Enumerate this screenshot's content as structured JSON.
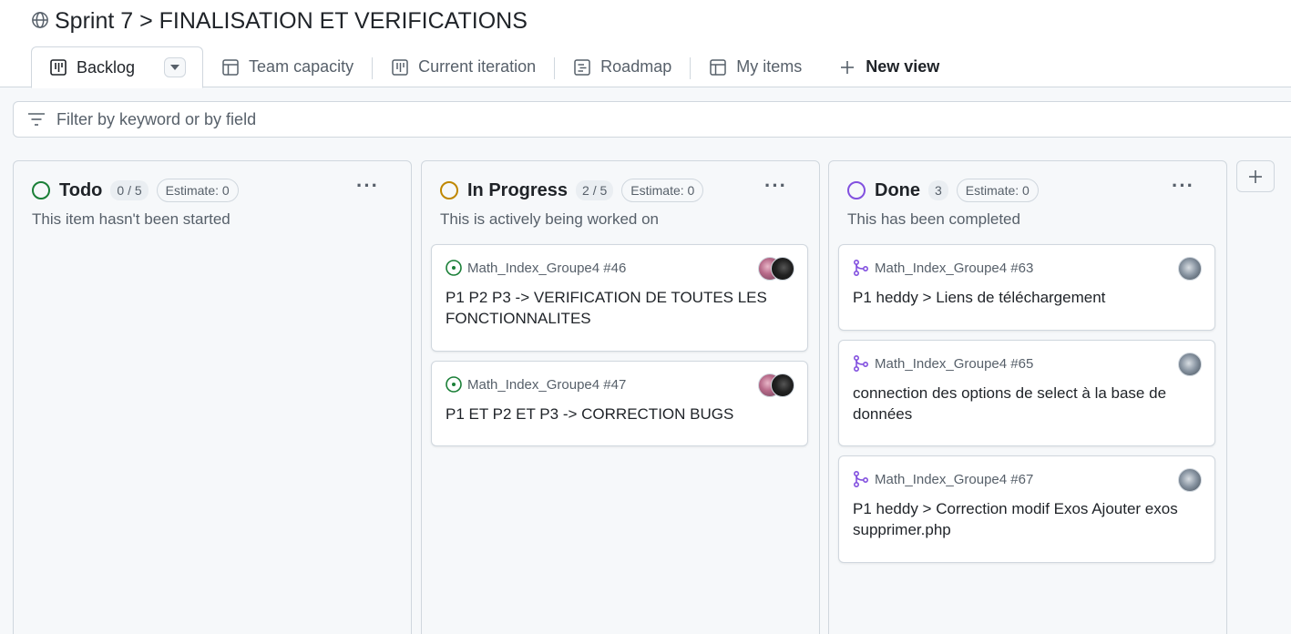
{
  "project": {
    "title": "Sprint 7 > FINALISATION ET VERIFICATIONS"
  },
  "tabs": [
    {
      "label": "Backlog"
    },
    {
      "label": "Team capacity"
    },
    {
      "label": "Current iteration"
    },
    {
      "label": "Roadmap"
    },
    {
      "label": "My items"
    },
    {
      "label": "New view"
    }
  ],
  "filter": {
    "placeholder": "Filter by keyword or by field"
  },
  "columns": [
    {
      "name": "Todo",
      "count": "0 / 5",
      "estimate": "Estimate: 0",
      "description": "This item hasn't been started",
      "color": "#1a7f37",
      "cards": []
    },
    {
      "name": "In Progress",
      "count": "2 / 5",
      "estimate": "Estimate: 0",
      "description": "This is actively being worked on",
      "color": "#bf8700",
      "cards": [
        {
          "ref": "Math_Index_Groupe4 #46",
          "title": "P1 P2 P3 -> VERIFICATION DE TOUTES LES FONCTIONNALITES",
          "icon": "issue-open-icon"
        },
        {
          "ref": "Math_Index_Groupe4 #47",
          "title": "P1 ET P2 ET P3 -> CORRECTION BUGS",
          "icon": "issue-open-icon"
        }
      ]
    },
    {
      "name": "Done",
      "count": "3",
      "estimate": "Estimate: 0",
      "description": "This has been completed",
      "color": "#8250df",
      "cards": [
        {
          "ref": "Math_Index_Groupe4 #63",
          "title": "P1 heddy > Liens de téléchargement",
          "icon": "pull-request-merged-icon"
        },
        {
          "ref": "Math_Index_Groupe4 #65",
          "title": "connection des options de select à la base de données",
          "icon": "pull-request-merged-icon"
        },
        {
          "ref": "Math_Index_Groupe4 #67",
          "title": "P1 heddy > Correction modif Exos Ajouter exos supprimer.php",
          "icon": "pull-request-merged-icon"
        }
      ]
    }
  ],
  "colors": {
    "issue_open": "#1a7f37",
    "merged": "#8250df",
    "border": "#d0d7de",
    "muted": "#57606a"
  }
}
